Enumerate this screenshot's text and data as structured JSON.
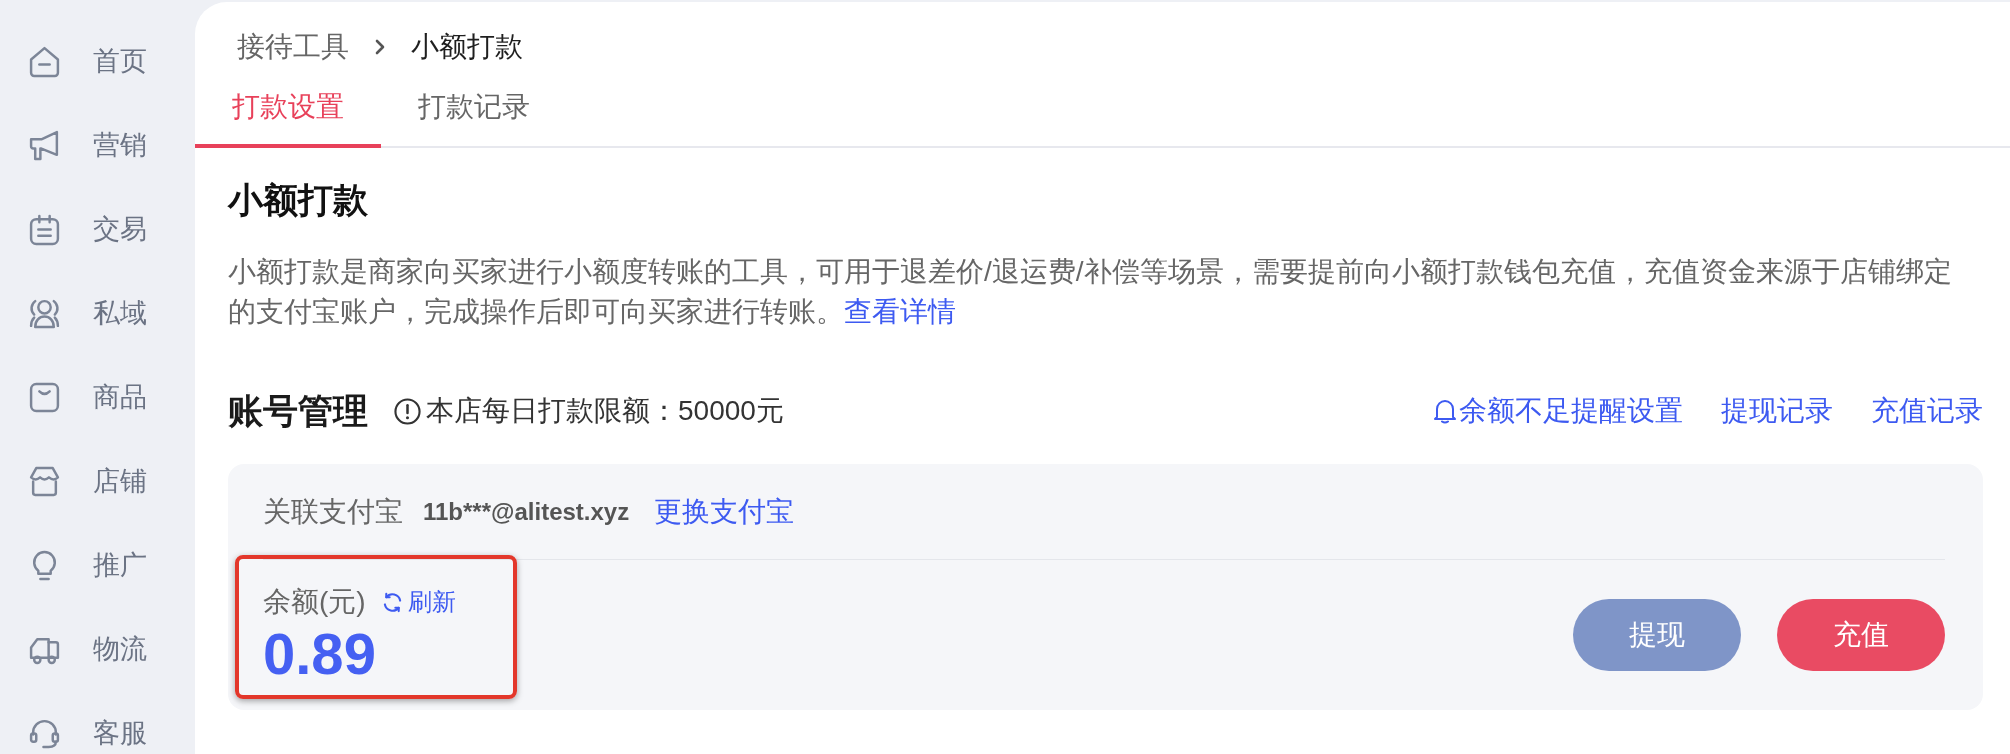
{
  "sidebar": {
    "items": [
      {
        "label": "首页"
      },
      {
        "label": "营销"
      },
      {
        "label": "交易"
      },
      {
        "label": "私域"
      },
      {
        "label": "商品"
      },
      {
        "label": "店铺"
      },
      {
        "label": "推广"
      },
      {
        "label": "物流"
      },
      {
        "label": "客服"
      }
    ]
  },
  "breadcrumb": [
    {
      "label": "接待工具",
      "current": false
    },
    {
      "label": "小额打款",
      "current": true
    }
  ],
  "tabs": [
    {
      "label": "打款设置",
      "selected": true
    },
    {
      "label": "打款记录",
      "selected": false
    }
  ],
  "intro": {
    "title": "小额打款",
    "text": "小额打款是商家向买家进行小额度转账的工具，可用于退差价/退运费/补偿等场景，需要提前向小额打款钱包充值，充值资金来源于店铺绑定的支付宝账户，完成操作后即可向买家进行转账。",
    "link": "查看详情"
  },
  "account": {
    "title": "账号管理",
    "limit": "本店每日打款限额：50000元",
    "links": [
      {
        "label": "余额不足提醒设置",
        "kind": "reminder"
      },
      {
        "label": "提现记录",
        "kind": "plain"
      },
      {
        "label": "充值记录",
        "kind": "plain"
      }
    ],
    "alipay": {
      "label": "关联支付宝",
      "account": "11b***@alitest.xyz",
      "change_link": "更换支付宝"
    },
    "balance": {
      "label": "余额(元)",
      "refresh": "刷新",
      "amount": "0.89",
      "highlighted": true
    },
    "buttons": [
      {
        "label": "提现",
        "kind": "secondary"
      },
      {
        "label": "充值",
        "kind": "primary"
      }
    ]
  }
}
